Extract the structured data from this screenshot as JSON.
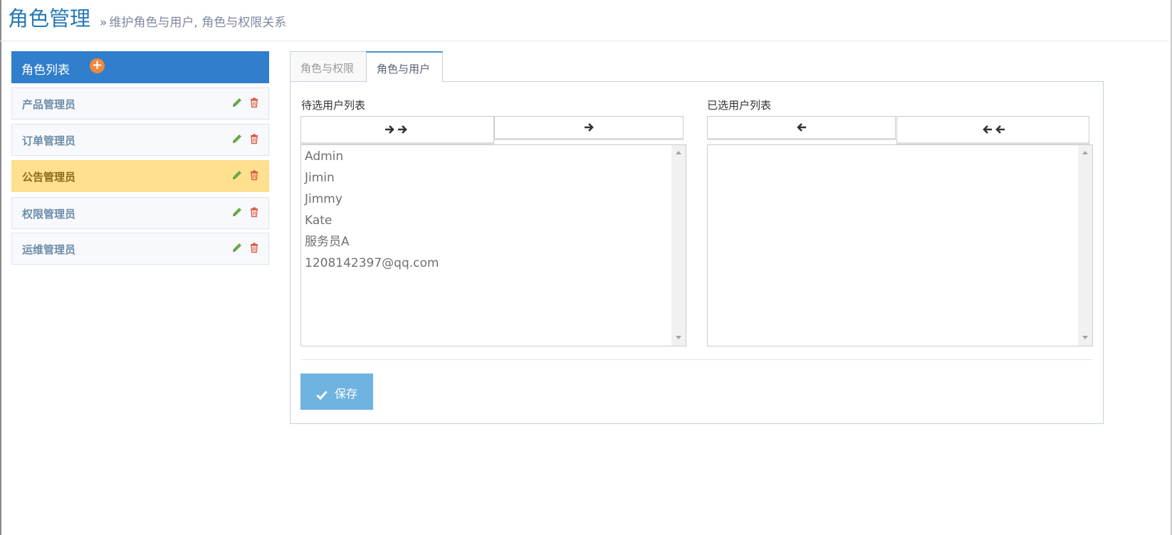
{
  "header": {
    "title": "角色管理",
    "raquo": "»",
    "subtitle": "维护角色与用户, 角色与权限关系"
  },
  "role_panel": {
    "title": "角色列表",
    "add_icon": "plus-circle-icon",
    "roles": [
      {
        "label": "产品管理员",
        "active": false
      },
      {
        "label": "订单管理员",
        "active": false
      },
      {
        "label": "公告管理员",
        "active": true
      },
      {
        "label": "权限管理员",
        "active": false
      },
      {
        "label": "运维管理员",
        "active": false
      }
    ],
    "edit_icon": "pencil-icon",
    "delete_icon": "trash-icon"
  },
  "tabs": [
    {
      "label": "角色与权限",
      "active": false
    },
    {
      "label": "角色与用户",
      "active": true
    }
  ],
  "dual_list": {
    "available_label": "待选用户列表",
    "selected_label": "已选用户列表",
    "move_all_right_icon": "double-arrow-right-icon",
    "move_right_icon": "arrow-right-icon",
    "move_left_icon": "arrow-left-icon",
    "move_all_left_icon": "double-arrow-left-icon",
    "available_users": [
      "Admin",
      "Jimin",
      "Jimmy",
      "Kate",
      "服务员A",
      "1208142397@qq.com"
    ],
    "selected_users": []
  },
  "save_button": {
    "label": "保存",
    "icon": "check-icon"
  },
  "colors": {
    "primary": "#307ecc",
    "active_role": "#ffe08f",
    "save": "#6fb3e0",
    "accent_orange": "#f0883e",
    "edit_green": "#69aa46",
    "delete_red": "#dd5a43"
  }
}
